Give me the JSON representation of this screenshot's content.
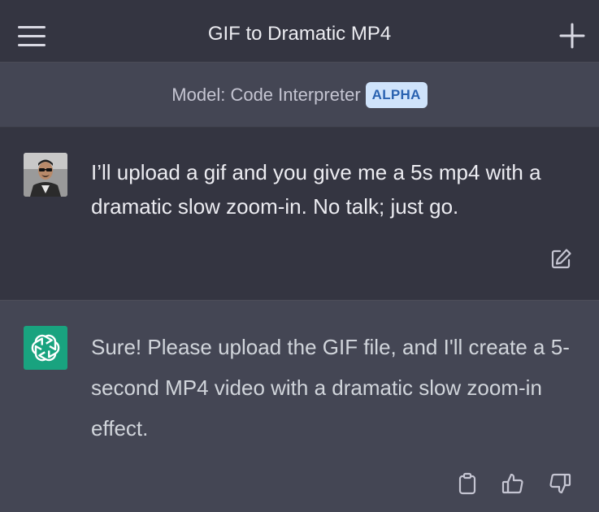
{
  "header": {
    "title": "GIF to Dramatic MP4",
    "menu_icon": "hamburger-menu-icon",
    "new_chat_icon": "plus-icon"
  },
  "model_bar": {
    "label": "Model: Code Interpreter",
    "badge": "ALPHA"
  },
  "messages": [
    {
      "role": "user",
      "avatar": "user-avatar",
      "text": "I’ll upload a gif and you give me a 5s mp4 with a dramatic slow zoom-in. No talk; just go.",
      "actions": [
        "edit-icon"
      ]
    },
    {
      "role": "assistant",
      "avatar": "chatgpt-logo-icon",
      "text": "Sure! Please upload the GIF file, and I'll create a 5-second MP4 video with a dramatic slow zoom-in effect.",
      "actions": [
        "copy-icon",
        "thumbs-up-icon",
        "thumbs-down-icon"
      ]
    }
  ],
  "colors": {
    "background": "#343541",
    "assistant_background": "#444654",
    "text": "#ececf1",
    "badge_background": "#cfe3fb",
    "badge_text": "#2a62b0",
    "chatgpt_green": "#19a37f",
    "top_accent": "#2f86d6"
  }
}
